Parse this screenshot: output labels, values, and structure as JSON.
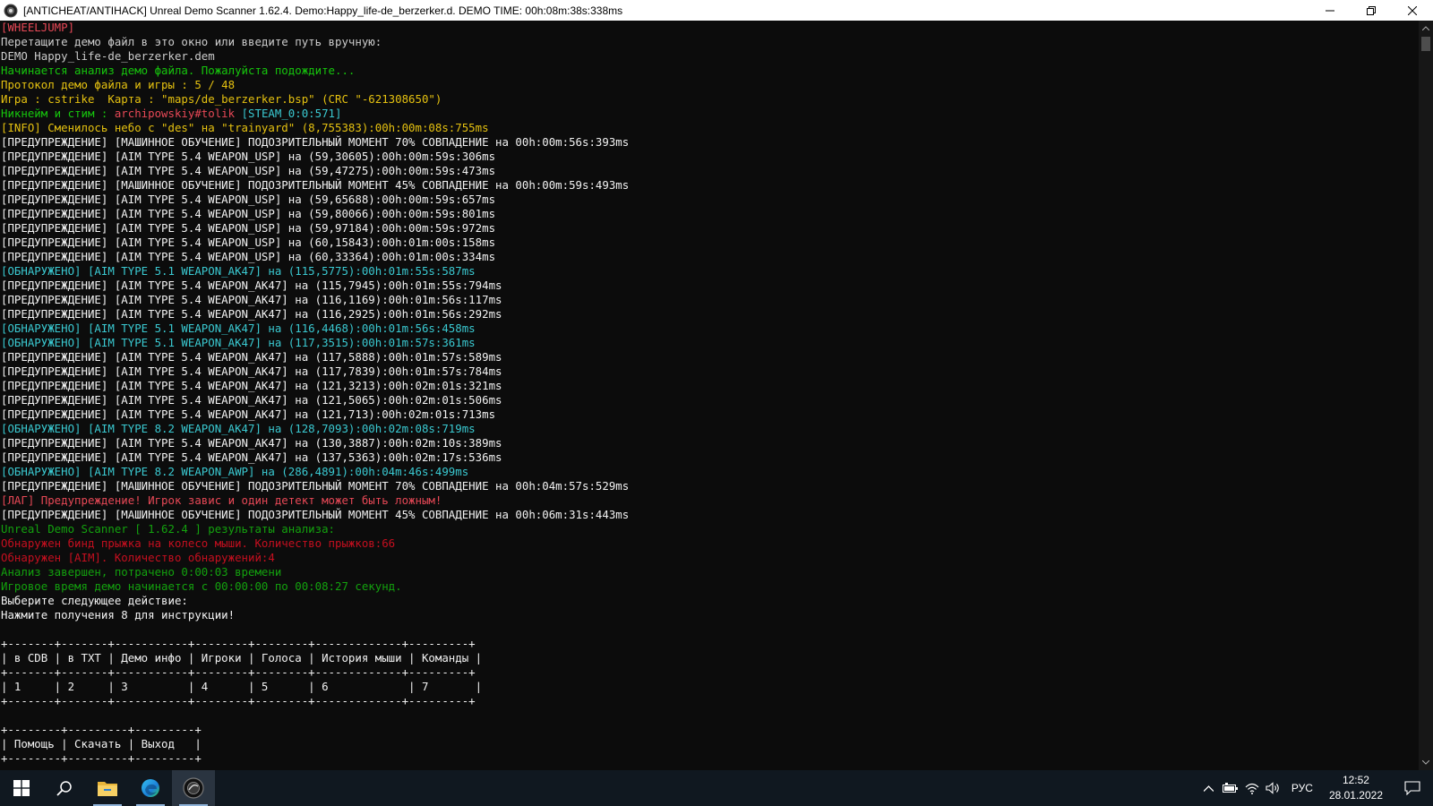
{
  "window": {
    "title": "[ANTICHEAT/ANTIHACK] Unreal Demo Scanner 1.62.4. Demo:Happy_life-de_berzerker.d. DEMO TIME: 00h:08m:38s:338ms",
    "minimize_glyph": "—",
    "maximize_glyph": "❐",
    "close_glyph": "✕"
  },
  "colors": {
    "console_bg": "#0c0c0c",
    "gray": "#cccccc",
    "red": "#e74856",
    "green": "#16c60c",
    "yellow": "#e5c110",
    "cyan": "#3ac9d1",
    "white": "#f2f2f2",
    "taskbar_bg": "#101820"
  },
  "console": {
    "lines": [
      {
        "text": "[WHEELJUMP]",
        "color": "red"
      },
      {
        "text": "Перетащите демо файл в это окно или введите путь вручную:",
        "color": "gray"
      },
      {
        "text": "DEMO Happy_life-de_berzerker.dem",
        "color": "gray"
      },
      {
        "text": "Начинается анализ демо файла. Пожалуйста подождите...",
        "color": "green"
      },
      {
        "text": "Протокол демо файла и игры : 5 / 48",
        "color": "yellow"
      },
      {
        "text": "Игра : cstrike  Карта : \"maps/de_berzerker.bsp\" (CRC \"-621308650\")",
        "color": "yellow"
      },
      {
        "text": "Никнейм и стим : archipowskiy#tolik [STEAM_0:0:571]",
        "color": "green",
        "parts": [
          {
            "text": "Никнейм и стим : ",
            "color": "green"
          },
          {
            "text": "archipowskiy#tolik ",
            "color": "red"
          },
          {
            "text": "[STEAM_0:0:571]",
            "color": "cyan"
          }
        ]
      },
      {
        "text": "[INFO] Сменилось небо с \"des\" на \"trainyard\" (8,755383):00h:00m:08s:755ms",
        "color": "yellow"
      },
      {
        "text": "[ПРЕДУПРЕЖДЕНИЕ] [МАШИННОЕ ОБУЧЕНИЕ] ПОДОЗРИТЕЛЬНЫЙ МОМЕНТ 70% СОВПАДЕНИЕ на 00h:00m:56s:393ms",
        "color": "white"
      },
      {
        "text": "[ПРЕДУПРЕЖДЕНИЕ] [AIM TYPE 5.4 WEAPON_USP] на (59,30605):00h:00m:59s:306ms",
        "color": "white"
      },
      {
        "text": "[ПРЕДУПРЕЖДЕНИЕ] [AIM TYPE 5.4 WEAPON_USP] на (59,47275):00h:00m:59s:473ms",
        "color": "white"
      },
      {
        "text": "[ПРЕДУПРЕЖДЕНИЕ] [МАШИННОЕ ОБУЧЕНИЕ] ПОДОЗРИТЕЛЬНЫЙ МОМЕНТ 45% СОВПАДЕНИЕ на 00h:00m:59s:493ms",
        "color": "white"
      },
      {
        "text": "[ПРЕДУПРЕЖДЕНИЕ] [AIM TYPE 5.4 WEAPON_USP] на (59,65688):00h:00m:59s:657ms",
        "color": "white"
      },
      {
        "text": "[ПРЕДУПРЕЖДЕНИЕ] [AIM TYPE 5.4 WEAPON_USP] на (59,80066):00h:00m:59s:801ms",
        "color": "white"
      },
      {
        "text": "[ПРЕДУПРЕЖДЕНИЕ] [AIM TYPE 5.4 WEAPON_USP] на (59,97184):00h:00m:59s:972ms",
        "color": "white"
      },
      {
        "text": "[ПРЕДУПРЕЖДЕНИЕ] [AIM TYPE 5.4 WEAPON_USP] на (60,15843):00h:01m:00s:158ms",
        "color": "white"
      },
      {
        "text": "[ПРЕДУПРЕЖДЕНИЕ] [AIM TYPE 5.4 WEAPON_USP] на (60,33364):00h:01m:00s:334ms",
        "color": "white"
      },
      {
        "text": "[ОБНАРУЖЕНО] [AIM TYPE 5.1 WEAPON_AK47] на (115,5775):00h:01m:55s:587ms",
        "color": "cyan"
      },
      {
        "text": "[ПРЕДУПРЕЖДЕНИЕ] [AIM TYPE 5.4 WEAPON_AK47] на (115,7945):00h:01m:55s:794ms",
        "color": "white"
      },
      {
        "text": "[ПРЕДУПРЕЖДЕНИЕ] [AIM TYPE 5.4 WEAPON_AK47] на (116,1169):00h:01m:56s:117ms",
        "color": "white"
      },
      {
        "text": "[ПРЕДУПРЕЖДЕНИЕ] [AIM TYPE 5.4 WEAPON_AK47] на (116,2925):00h:01m:56s:292ms",
        "color": "white"
      },
      {
        "text": "[ОБНАРУЖЕНО] [AIM TYPE 5.1 WEAPON_AK47] на (116,4468):00h:01m:56s:458ms",
        "color": "cyan"
      },
      {
        "text": "[ОБНАРУЖЕНО] [AIM TYPE 5.1 WEAPON_AK47] на (117,3515):00h:01m:57s:361ms",
        "color": "cyan"
      },
      {
        "text": "[ПРЕДУПРЕЖДЕНИЕ] [AIM TYPE 5.4 WEAPON_AK47] на (117,5888):00h:01m:57s:589ms",
        "color": "white"
      },
      {
        "text": "[ПРЕДУПРЕЖДЕНИЕ] [AIM TYPE 5.4 WEAPON_AK47] на (117,7839):00h:01m:57s:784ms",
        "color": "white"
      },
      {
        "text": "[ПРЕДУПРЕЖДЕНИЕ] [AIM TYPE 5.4 WEAPON_AK47] на (121,3213):00h:02m:01s:321ms",
        "color": "white"
      },
      {
        "text": "[ПРЕДУПРЕЖДЕНИЕ] [AIM TYPE 5.4 WEAPON_AK47] на (121,5065):00h:02m:01s:506ms",
        "color": "white"
      },
      {
        "text": "[ПРЕДУПРЕЖДЕНИЕ] [AIM TYPE 5.4 WEAPON_AK47] на (121,713):00h:02m:01s:713ms",
        "color": "white"
      },
      {
        "text": "[ОБНАРУЖЕНО] [AIM TYPE 8.2 WEAPON_AK47] на (128,7093):00h:02m:08s:719ms",
        "color": "cyan"
      },
      {
        "text": "[ПРЕДУПРЕЖДЕНИЕ] [AIM TYPE 5.4 WEAPON_AK47] на (130,3887):00h:02m:10s:389ms",
        "color": "white"
      },
      {
        "text": "[ПРЕДУПРЕЖДЕНИЕ] [AIM TYPE 5.4 WEAPON_AK47] на (137,5363):00h:02m:17s:536ms",
        "color": "white"
      },
      {
        "text": "[ОБНАРУЖЕНО] [AIM TYPE 8.2 WEAPON_AWP] на (286,4891):00h:04m:46s:499ms",
        "color": "cyan"
      },
      {
        "text": "[ПРЕДУПРЕЖДЕНИЕ] [МАШИННОЕ ОБУЧЕНИЕ] ПОДОЗРИТЕЛЬНЫЙ МОМЕНТ 70% СОВПАДЕНИЕ на 00h:04m:57s:529ms",
        "color": "white"
      },
      {
        "text": "[ЛАГ] Предупреждение! Игрок завис и один детект может быть ложным!",
        "color": "red"
      },
      {
        "text": "[ПРЕДУПРЕЖДЕНИЕ] [МАШИННОЕ ОБУЧЕНИЕ] ПОДОЗРИТЕЛЬНЫЙ МОМЕНТ 45% СОВПАДЕНИЕ на 00h:06m:31s:443ms",
        "color": "white"
      },
      {
        "text": "Unreal Demo Scanner [ 1.62.4 ] результаты анализа:",
        "color": "darkgreen"
      },
      {
        "text": "Обнаружен бинд прыжка на колесо мыши. Количество прыжков:66",
        "color": "darkred"
      },
      {
        "text": "Обнаружен [AIM]. Количество обнаружений:4",
        "color": "darkred"
      },
      {
        "text": "Анализ завершен, потрачено 0:00:03 времени",
        "color": "darkgreen"
      },
      {
        "text": "Игровое время демо начинается с 00:00:00 по 00:08:27 секунд.",
        "color": "darkgreen"
      },
      {
        "text": "Выберите следующее действие:",
        "color": "white"
      },
      {
        "text": "Нажмите получения 8 для инструкции!",
        "color": "white"
      },
      {
        "text": "",
        "color": "white"
      },
      {
        "text": "+-------+-------+-----------+--------+--------+-------------+---------+",
        "color": "white"
      },
      {
        "text": "| в CDB | в TXT | Демо инфо | Игроки | Голоса | История мыши | Команды |",
        "color": "white"
      },
      {
        "text": "+-------+-------+-----------+--------+--------+-------------+---------+",
        "color": "white"
      },
      {
        "text": "| 1     | 2     | 3         | 4      | 5      | 6            | 7       |",
        "color": "white"
      },
      {
        "text": "+-------+-------+-----------+--------+--------+-------------+---------+",
        "color": "white"
      },
      {
        "text": "",
        "color": "white"
      },
      {
        "text": "+--------+---------+---------+",
        "color": "white"
      },
      {
        "text": "| Помощь | Скачать | Выход   |",
        "color": "white"
      },
      {
        "text": "+--------+---------+---------+",
        "color": "white"
      }
    ]
  },
  "taskbar": {
    "start_icon": "windows-start-icon",
    "search_icon": "search-icon",
    "apps": [
      {
        "name": "file-explorer-icon"
      },
      {
        "name": "edge-browser-icon"
      },
      {
        "name": "demo-scanner-app-icon"
      }
    ],
    "tray": {
      "chevron": "^",
      "language": "РУС",
      "time": "12:52",
      "date": "28.01.2022"
    }
  }
}
